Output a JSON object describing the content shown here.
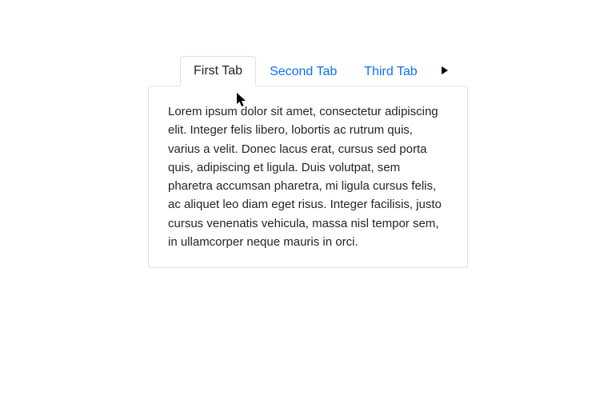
{
  "tabs": {
    "items": [
      {
        "label": "First Tab",
        "active": true
      },
      {
        "label": "Second Tab",
        "active": false
      },
      {
        "label": "Third Tab",
        "active": false
      }
    ]
  },
  "panel": {
    "content": "Lorem ipsum dolor sit amet, consectetur adipiscing elit. Integer felis libero, lobortis ac rutrum quis, varius a velit. Donec lacus erat, cursus sed porta quis, adipiscing et ligula. Duis volutpat, sem pharetra accumsan pharetra, mi ligula cursus felis, ac aliquet leo diam eget risus. Integer facilisis, justo cursus venenatis vehicula, massa nisl tempor sem, in ullamcorper neque mauris in orci."
  },
  "colors": {
    "link": "#0d6efd",
    "text": "#212529",
    "border": "#dee2e6"
  }
}
